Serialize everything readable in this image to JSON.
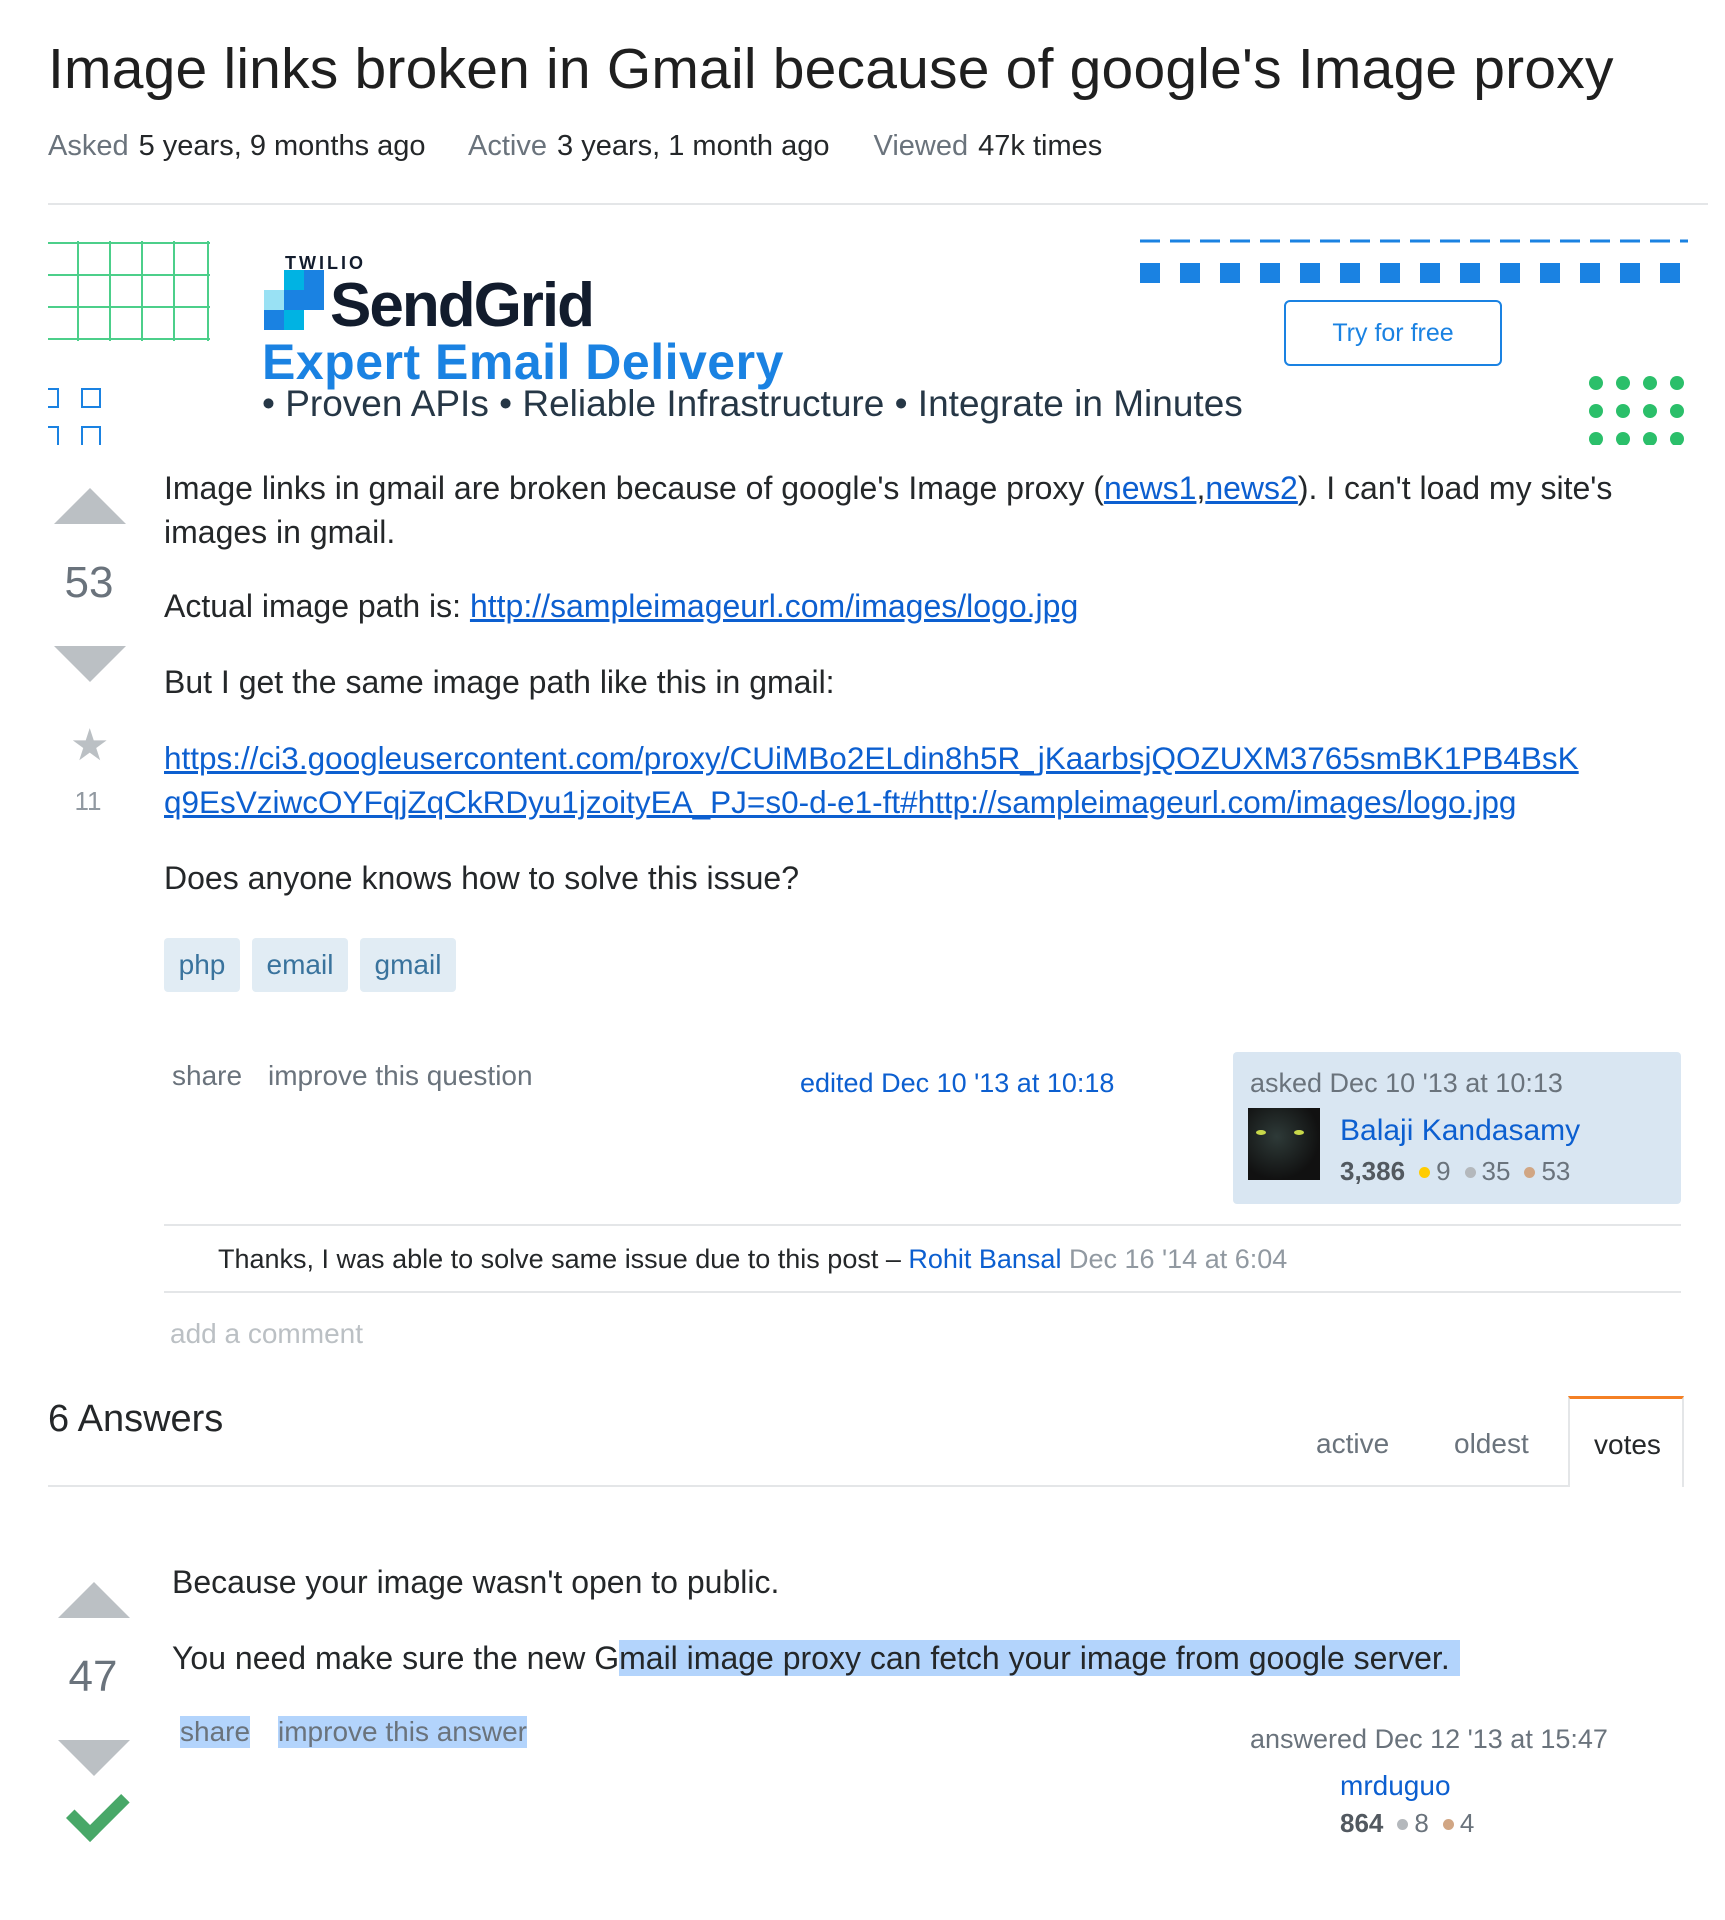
{
  "question": {
    "title": "Image links broken in Gmail because of google's Image proxy",
    "meta": {
      "asked_label": "Asked",
      "asked_value": "5 years, 9 months ago",
      "active_label": "Active",
      "active_value": "3 years, 1 month ago",
      "viewed_label": "Viewed",
      "viewed_value": "47k times"
    },
    "votes": "53",
    "favorites": "11",
    "body": {
      "p1_before": "Image links in gmail are broken because of google's Image proxy (",
      "link1": "news1",
      "comma": ",",
      "link2": "news2",
      "p1_after": "). I can't load my site's images in gmail.",
      "p2_label": "Actual image path is: ",
      "p2_link": "http://sampleimageurl.com/images/logo.jpg",
      "p3": "But I get the same image path like this in gmail:",
      "p4_link_line1": "https://ci3.googleusercontent.com/proxy/CUiMBo2ELdin8h5R_jKaarbsjQOZUXM3765smBK1PB4BsK",
      "p4_link_line2": "q9EsVziwcOYFqjZqCkRDyu1jzoityEA_PJ=s0-d-e1-ft#http://sampleimageurl.com/images/logo.jpg",
      "p5": "Does anyone knows how to solve this issue?"
    },
    "tags": [
      "php",
      "email",
      "gmail"
    ],
    "actions": {
      "share": "share",
      "improve": "improve this question"
    },
    "edited": "edited Dec 10 '13 at 10:18",
    "owner": {
      "asked": "asked Dec 10 '13 at 10:13",
      "name": "Balaji Kandasamy",
      "rep": "3,386",
      "gold": "9",
      "silver": "35",
      "bronze": "53"
    },
    "comment": {
      "text": "Thanks, I was able to solve same issue due to this post – ",
      "user": "Rohit Bansal",
      "date": " Dec 16 '14 at 6:04"
    },
    "add_comment": "add a comment"
  },
  "ad": {
    "brand_small": "TWILIO",
    "brand": "SendGrid",
    "headline": "Expert Email Delivery",
    "subline": "• Proven APIs • Reliable Infrastructure • Integrate in Minutes",
    "cta": "Try for free"
  },
  "answers": {
    "count_label": "6 Answers",
    "tabs": [
      "active",
      "oldest",
      "votes"
    ],
    "active_tab": "votes"
  },
  "answer1": {
    "votes": "47",
    "p1": "Because your image wasn't open to public.",
    "p2_before": "You need make sure the new G",
    "p2_highlight": "mail image proxy can fetch your image from google server.",
    "share": "share",
    "improve": "improve this answer",
    "answered": "answered Dec 12 '13 at 15:47",
    "user": "mrduguo",
    "rep": "864",
    "silver": "8",
    "bronze": "4"
  },
  "colors": {
    "link": "#0c5fd0",
    "sendgrid_blue": "#1a82e2",
    "accepted_green": "#48a868",
    "tag_bg": "#e1ecf4",
    "owner_bg": "#d9e6f2",
    "active_tab_accent": "#f48024",
    "selection": "#b3d4fc"
  }
}
